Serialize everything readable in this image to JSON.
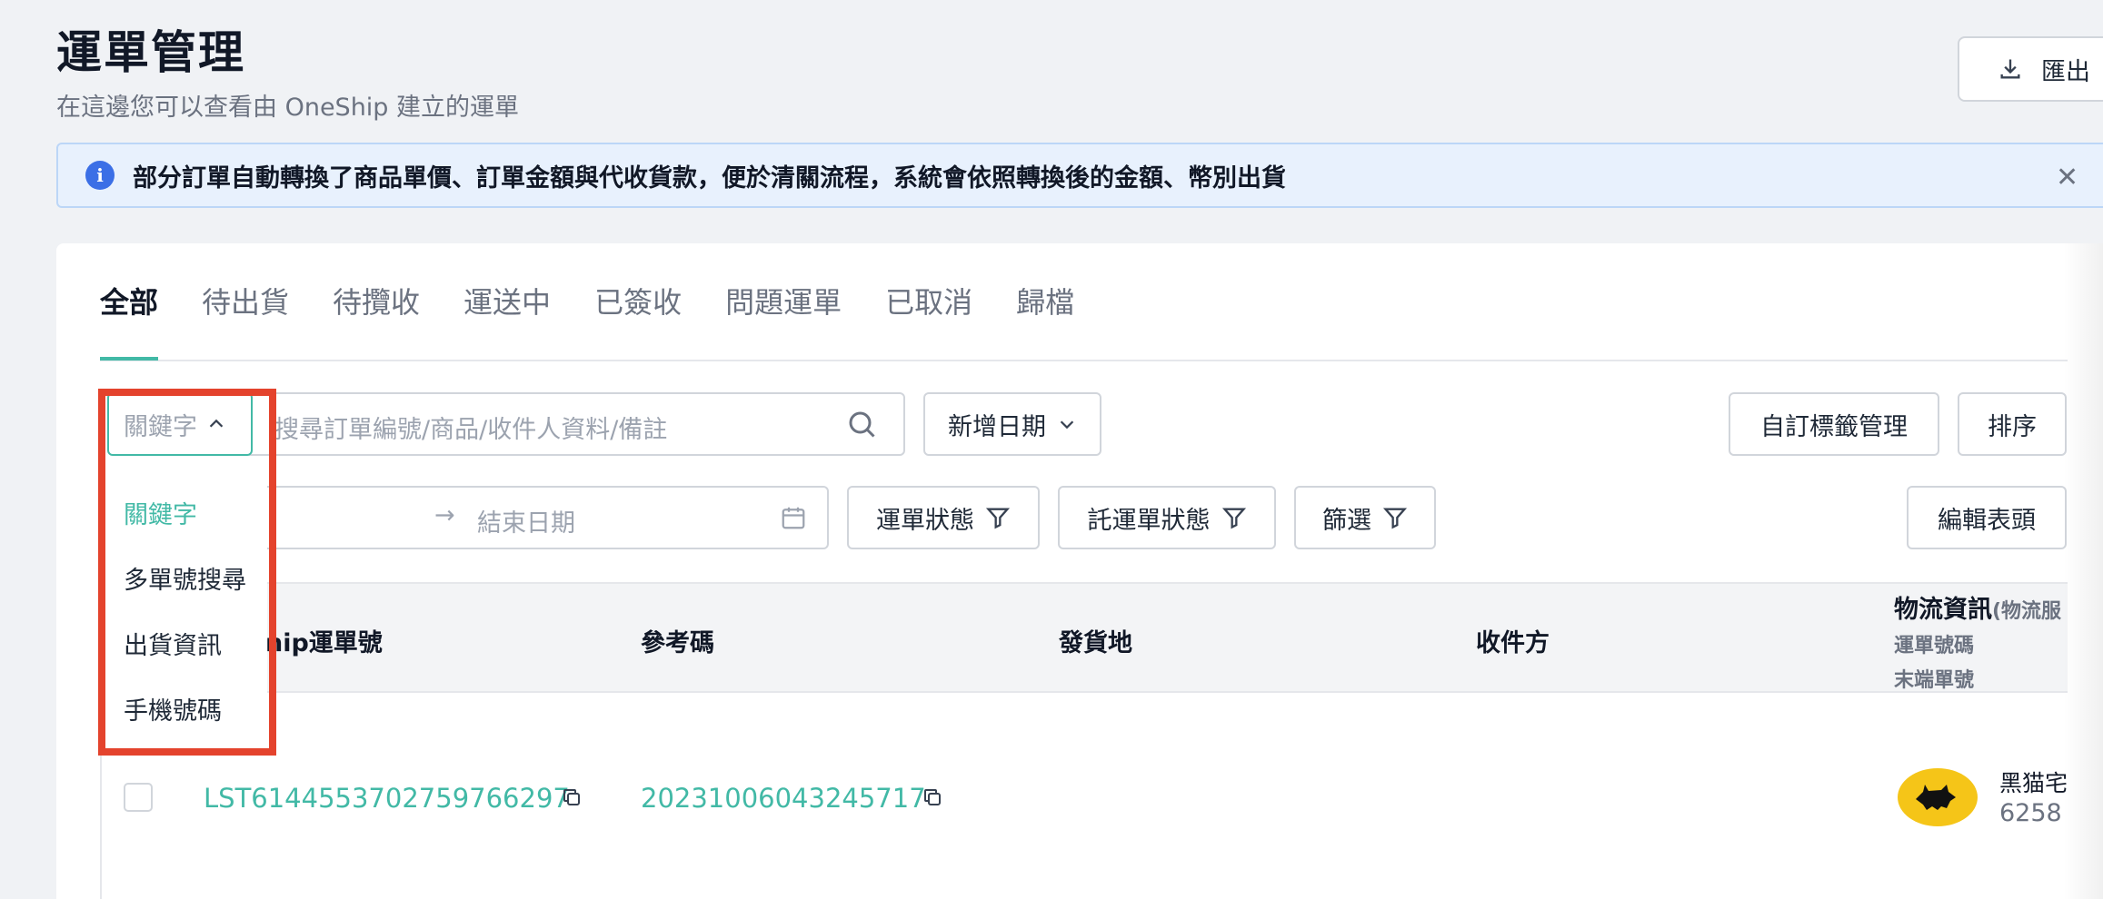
{
  "header": {
    "title": "運單管理",
    "subtitle": "在這邊您可以查看由 OneShip 建立的運單",
    "export_label": "匯出"
  },
  "banner": {
    "text": "部分訂單自動轉換了商品單價、訂單金額與代收貨款，便於清關流程，系統會依照轉換後的金額、幣別出貨"
  },
  "tabs": [
    {
      "label": "全部",
      "active": true
    },
    {
      "label": "待出貨"
    },
    {
      "label": "待攬收"
    },
    {
      "label": "運送中"
    },
    {
      "label": "已簽收"
    },
    {
      "label": "問題運單"
    },
    {
      "label": "已取消"
    },
    {
      "label": "歸檔"
    }
  ],
  "toolbar": {
    "search_type": "關鍵字",
    "search_placeholder": "搜尋訂單編號/商品/收件人資料/備註",
    "date_type": "新增日期",
    "tag_manage": "自訂標籤管理",
    "sort": "排序",
    "date_separator": "→",
    "end_date_placeholder": "結束日期",
    "status_filter": "運單狀態",
    "consignment_status_filter": "託運單狀態",
    "filter": "篩選",
    "edit_columns": "編輯表頭"
  },
  "dropdown": {
    "items": [
      "關鍵字",
      "多單號搜尋",
      "出貨資訊",
      "手機號碼"
    ],
    "selected": "關鍵字"
  },
  "table": {
    "columns": {
      "oneship_no": "nip運單號",
      "ref": "參考碼",
      "origin": "發貨地",
      "recipient": "收件方",
      "logistics": "物流資訊",
      "logistics_note": "(物流服",
      "logistics_sub1": "運單號碼",
      "logistics_sub2": "末端單號"
    },
    "rows": [
      {
        "oneship_no": "LST6144553702759766297",
        "ref": "20231006043245717",
        "carrier_name": "黑猫宅",
        "carrier_number": "6258"
      }
    ]
  },
  "colors": {
    "accent": "#42b9a6",
    "highlight_border": "#e4432d",
    "info": "#3b6fe6"
  }
}
